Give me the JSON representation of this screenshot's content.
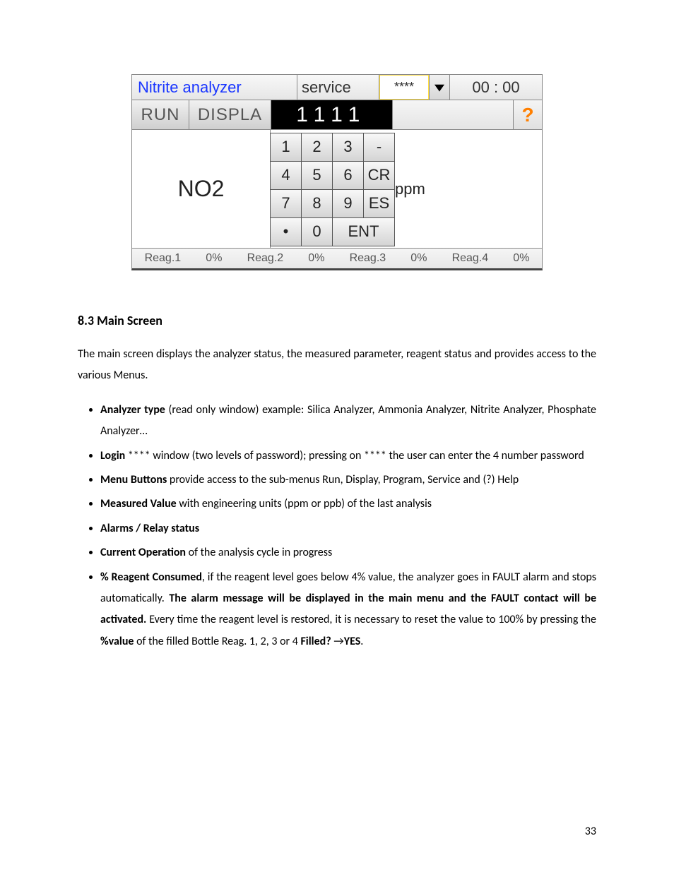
{
  "analyzer": {
    "title": "Nitrite analyzer",
    "mode": "service",
    "password_masked": "****",
    "clock": "00 : 00",
    "menu_run": "RUN",
    "menu_displ": "DISPLA",
    "entry_value": "1111",
    "help_label": "?",
    "parameter": "NO2",
    "unit_fragment": "ppm",
    "keypad": [
      "1",
      "2",
      "3",
      "-",
      "4",
      "5",
      "6",
      "CR",
      "7",
      "8",
      "9",
      "ES",
      "•",
      "0",
      "ENT"
    ],
    "reagents": [
      {
        "label": "Reag.1",
        "value": "0%"
      },
      {
        "label": "Reag.2",
        "value": "0%"
      },
      {
        "label": "Reag.3",
        "value": "0%"
      },
      {
        "label": "Reag.4",
        "value": "0%"
      }
    ]
  },
  "section": {
    "heading": "8.3  Main Screen",
    "intro": "The main screen displays the analyzer status, the measured parameter, reagent status and provides access to the various Menus.",
    "bullets": {
      "b1_bold": "Analyzer type",
      "b1_rest": " (read only window) example: Silica Analyzer, Ammonia Analyzer, Nitrite Analyzer, Phosphate Analyzer…",
      "b2_bold": "Login",
      "b2_rest": " **** window (two levels of password); pressing on **** the user can enter the 4 number password",
      "b3_bold": "Menu Buttons",
      "b3_rest": " provide access to the sub-menus Run, Display, Program, Service and (?) Help",
      "b4_bold": "Measured Value",
      "b4_rest": " with engineering units (ppm or ppb) of the last analysis",
      "b5_bold": "Alarms / Relay status",
      "b6_bold": "Current Operation",
      "b6_rest": " of the analysis cycle in progress",
      "b7_bold": "% Reagent Consumed",
      "b7_rest_a": ", if the reagent level goes below 4% value, the analyzer goes in FAULT alarm and stops automatically. ",
      "b7_bold2": "The alarm message will be displayed in the main menu and the FAULT contact will be activated.",
      "b7_rest_b": " Every time the reagent level is restored, it is necessary to reset the value to 100% by pressing the ",
      "b7_bold3": "%value",
      "b7_rest_c": " of the filled Bottle Reag. 1, 2, 3 or 4 ",
      "b7_bold4": "Filled?",
      "b7_arrow": " →",
      "b7_bold5": "YES",
      "b7_period": "."
    }
  },
  "page_number": "33"
}
